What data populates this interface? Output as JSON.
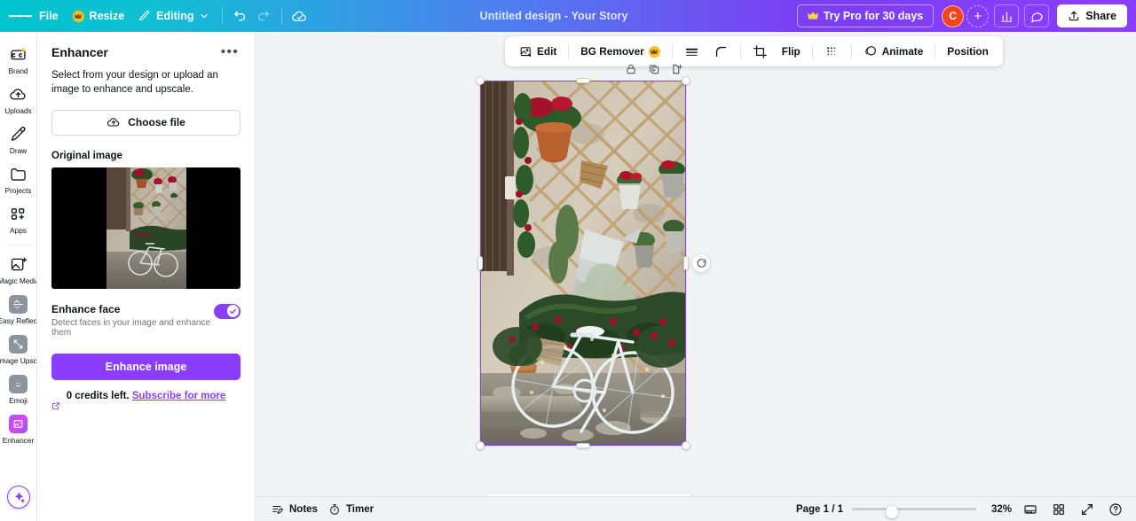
{
  "header": {
    "menu_icon": "hamburger-icon",
    "file_label": "File",
    "resize_label": "Resize",
    "resize_badge": "crown-icon",
    "editing_label": "Editing",
    "undo_icon": "undo-icon",
    "redo_icon": "redo-icon",
    "cloud_icon": "cloud-saved-icon",
    "doc_title": "Untitled design - Your Story",
    "pro_label": "Try Pro for 30 days",
    "avatar_initial": "C",
    "avatar_color": "#f4451f",
    "plus_label": "+",
    "insights_icon": "bar-chart-icon",
    "comment_icon": "comment-icon",
    "share_label": "Share",
    "gradient_start": "#00c4cc",
    "gradient_end": "#8b3dff"
  },
  "rail": {
    "items": [
      {
        "label": "Brand",
        "icon": "brand-icon",
        "active": false
      },
      {
        "label": "Uploads",
        "icon": "uploads-cloud-icon",
        "active": false
      },
      {
        "label": "Draw",
        "icon": "draw-pen-icon",
        "active": false
      },
      {
        "label": "Projects",
        "icon": "projects-folder-icon",
        "active": false
      },
      {
        "label": "Apps",
        "icon": "apps-grid-icon",
        "active": false
      }
    ],
    "app_items": [
      {
        "label": "Easy Reflec...",
        "icon": "easy-reflections-icon",
        "active": false
      },
      {
        "label": "Image Upsc...",
        "icon": "image-upscaler-icon",
        "active": false
      },
      {
        "label": "Emoji",
        "icon": "emoji-icon",
        "active": false
      },
      {
        "label": "Enhancer",
        "icon": "enhancer-icon",
        "active": true
      }
    ],
    "magic_button": "magic-sparkle-icon"
  },
  "panel": {
    "title": "Enhancer",
    "more_label": "•••",
    "description": "Select from your design or upload an image to enhance and upscale.",
    "choose_file_label": "Choose file",
    "choose_file_icon": "cloud-upload-icon",
    "original_image_label": "Original image",
    "thumbnail_alt": "white bicycle against stone wall",
    "enhance_face_title": "Enhance face",
    "enhance_face_desc": "Detect faces in your image and enhance them",
    "enhance_face_on": true,
    "enhance_button_label": "Enhance image",
    "credits_text": "0 credits left.",
    "subscribe_link": "Subscribe for more",
    "subscribe_icon": "external-link-icon",
    "accent_color": "#8b3dff"
  },
  "toolbar": {
    "edit_label": "Edit",
    "edit_icon": "image-edit-icon",
    "bg_remover_label": "BG Remover",
    "bg_remover_badge": "crown-icon",
    "lines_icon": "line-style-icon",
    "corner_icon": "corner-radius-icon",
    "crop_icon": "crop-icon",
    "flip_label": "Flip",
    "transparency_icon": "transparency-icon",
    "animate_label": "Animate",
    "animate_icon": "animate-icon",
    "position_label": "Position"
  },
  "canvas": {
    "top_icons": [
      "lock-icon",
      "duplicate-icon",
      "add-page-icon"
    ],
    "rotate_icon": "rotate-handle-icon",
    "selection_color": "#8b3dff",
    "page_toolbar_icons": [
      "rotate-icon",
      "lock-icon",
      "duplicate-icon",
      "delete-icon",
      "more-icon"
    ]
  },
  "footer": {
    "notes_label": "Notes",
    "notes_icon": "notes-icon",
    "timer_label": "Timer",
    "timer_icon": "timer-icon",
    "page_indicator": "Page 1 / 1",
    "zoom_value": "32%",
    "zoom_percent": 32,
    "presentation_icon": "presentation-view-icon",
    "grid_icon": "grid-view-icon",
    "fullscreen_icon": "fullscreen-icon",
    "help_icon": "help-icon"
  }
}
